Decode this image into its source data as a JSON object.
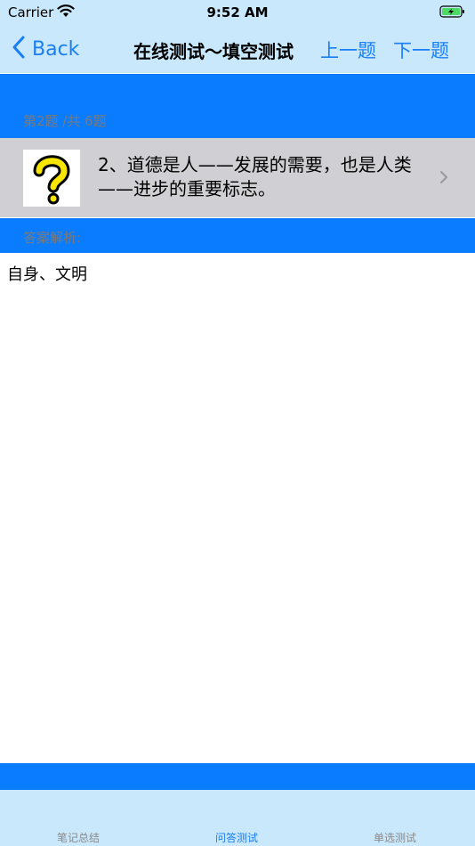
{
  "status_bar": {
    "carrier": "Carrier",
    "time": "9:52 AM"
  },
  "nav": {
    "back_label": "Back",
    "title": "在线测试～填空测试",
    "prev_label": "上一题",
    "next_label": "下一题"
  },
  "quiz": {
    "counter": "第2题 /共 6题",
    "question": "2、道德是人——发展的需要，也是人类——进步的重要标志。",
    "answer_label": "答案解析:",
    "answer": "自身、文明"
  },
  "tabs": [
    {
      "label": "笔记总结",
      "active": false
    },
    {
      "label": "问答测试",
      "active": true
    },
    {
      "label": "单选测试",
      "active": false
    }
  ],
  "colors": {
    "accent": "#1a7ef5",
    "band": "#0a7cff",
    "bar_bg": "#c9e8fb",
    "row_bg": "#d0d0d4"
  },
  "icons": [
    "wifi-icon",
    "battery-icon",
    "back-chevron-icon",
    "question-mark-icon",
    "chevron-right-icon"
  ]
}
